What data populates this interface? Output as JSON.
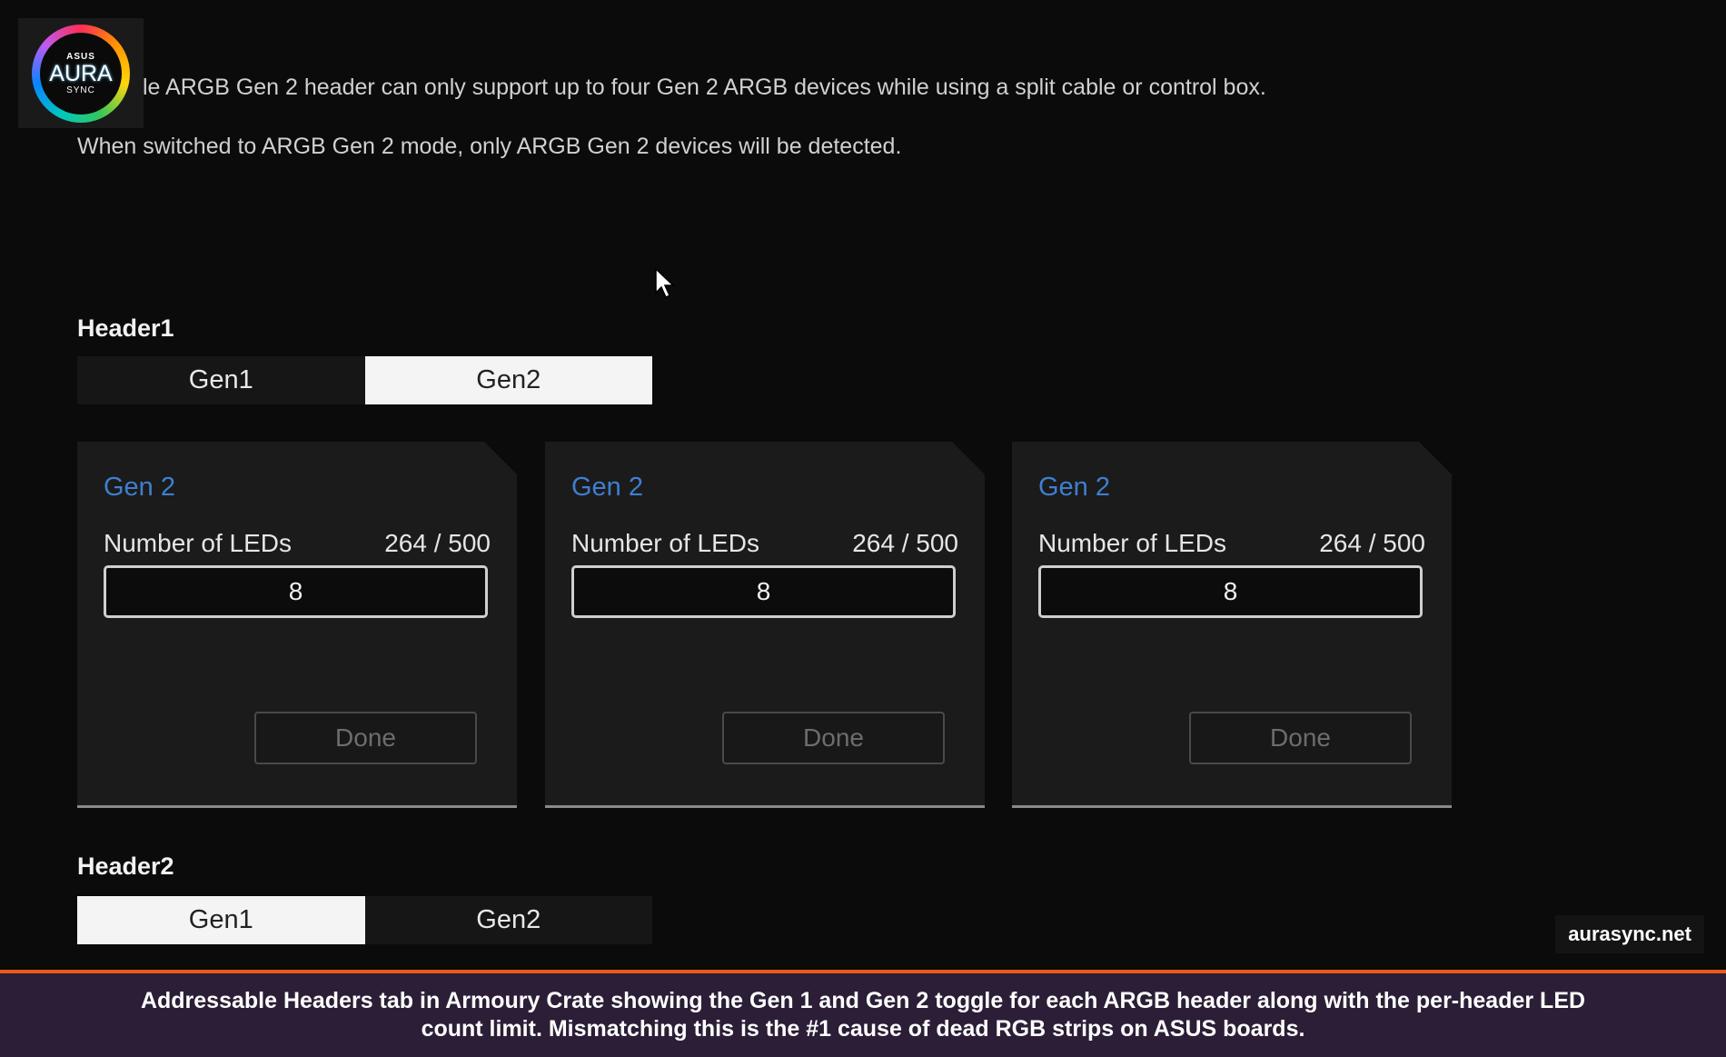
{
  "logo": {
    "brand": "ASUS",
    "name": "AURA",
    "sub": "SYNC"
  },
  "info": {
    "line1": "le ARGB Gen 2 header can only support up to four Gen 2 ARGB devices while using a split cable or control box.",
    "line2": "When switched to ARGB Gen 2 mode, only ARGB Gen 2 devices will be detected."
  },
  "headers": [
    {
      "label": "Header1",
      "options": [
        "Gen1",
        "Gen2"
      ],
      "selected": "Gen2"
    },
    {
      "label": "Header2",
      "options": [
        "Gen1",
        "Gen2"
      ],
      "selected": "Gen1"
    }
  ],
  "cards": [
    {
      "title": "Gen 2",
      "leds_label": "Number of LEDs",
      "leds_count": "264 / 500",
      "value": "8",
      "done_label": "Done"
    },
    {
      "title": "Gen 2",
      "leds_label": "Number of LEDs",
      "leds_count": "264 / 500",
      "value": "8",
      "done_label": "Done"
    },
    {
      "title": "Gen 2",
      "leds_label": "Number of LEDs",
      "leds_count": "264 / 500",
      "value": "8",
      "done_label": "Done"
    }
  ],
  "watermark": "aurasync.net",
  "caption": "Addressable Headers tab in Armoury Crate showing the Gen 1 and Gen 2 toggle for each ARGB header along with the per-header LED count limit. Mismatching this is the #1 cause of dead RGB strips on ASUS boards.",
  "colors": {
    "accent_blue": "#3f7fd0",
    "caption_bar": "#2b1e36",
    "caption_border": "#e8591a"
  }
}
